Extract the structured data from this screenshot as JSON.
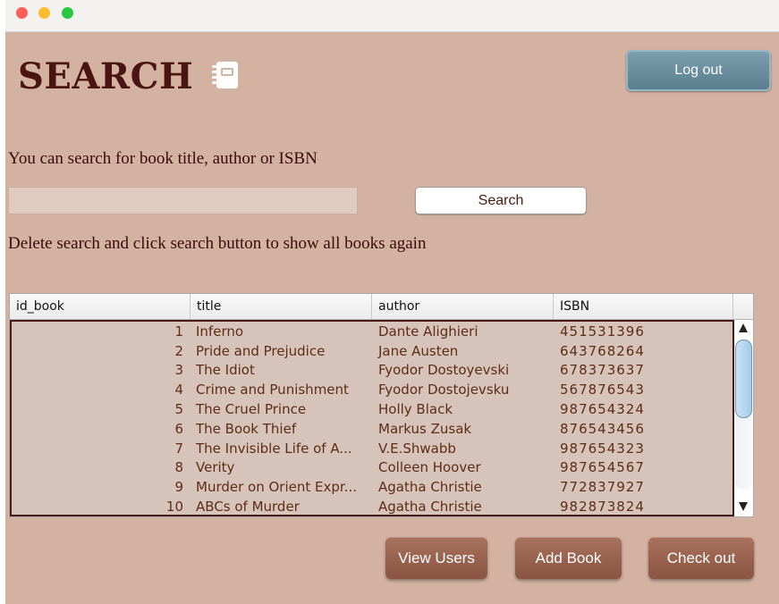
{
  "window": {
    "traffic_lights": {
      "close_color": "#fe5f57",
      "minimize_color": "#febc2e",
      "maximize_color": "#28c840"
    }
  },
  "header": {
    "title": "SEARCH",
    "title_icon": "notebook-icon",
    "logout_label": "Log out"
  },
  "search": {
    "hint": "You can search for book title, author or ISBN",
    "input_value": "",
    "button_label": "Search",
    "reset_hint": "Delete search and click search button to show all books again"
  },
  "table": {
    "columns": [
      "id_book",
      "title",
      "author",
      "ISBN"
    ],
    "rows": [
      {
        "id": "1",
        "title": "Inferno",
        "author": "Dante Alighieri",
        "isbn": "451531396"
      },
      {
        "id": "2",
        "title": "Pride and Prejudice",
        "author": "Jane Austen",
        "isbn": "643768264"
      },
      {
        "id": "3",
        "title": "The Idiot",
        "author": "Fyodor Dostoyevski",
        "isbn": "678373637"
      },
      {
        "id": "4",
        "title": "Crime and Punishment",
        "author": "Fyodor Dostojevsku",
        "isbn": "567876543"
      },
      {
        "id": "5",
        "title": "The Cruel Prince",
        "author": "Holly Black",
        "isbn": "987654324"
      },
      {
        "id": "6",
        "title": "The Book Thief",
        "author": "Markus Zusak",
        "isbn": "876543456"
      },
      {
        "id": "7",
        "title": "The Invisible Life of A...",
        "author": "V.E.Shwabb",
        "isbn": "987654323"
      },
      {
        "id": "8",
        "title": "Verity",
        "author": "Colleen Hoover",
        "isbn": "987654567"
      },
      {
        "id": "9",
        "title": "Murder on Orient Expr...",
        "author": "Agatha Christie",
        "isbn": "772837927"
      },
      {
        "id": "10",
        "title": "ABCs of Murder",
        "author": "Agatha Christie",
        "isbn": "982873824"
      }
    ]
  },
  "actions": {
    "view_users_label": "View Users",
    "add_book_label": "Add Book",
    "check_out_label": "Check out"
  },
  "colors": {
    "background": "#d3b2a1",
    "title_text": "#4b1411",
    "logout_button": "#6a8fa0",
    "action_button": "#9a6251",
    "table_body": "#d6c4ba"
  }
}
